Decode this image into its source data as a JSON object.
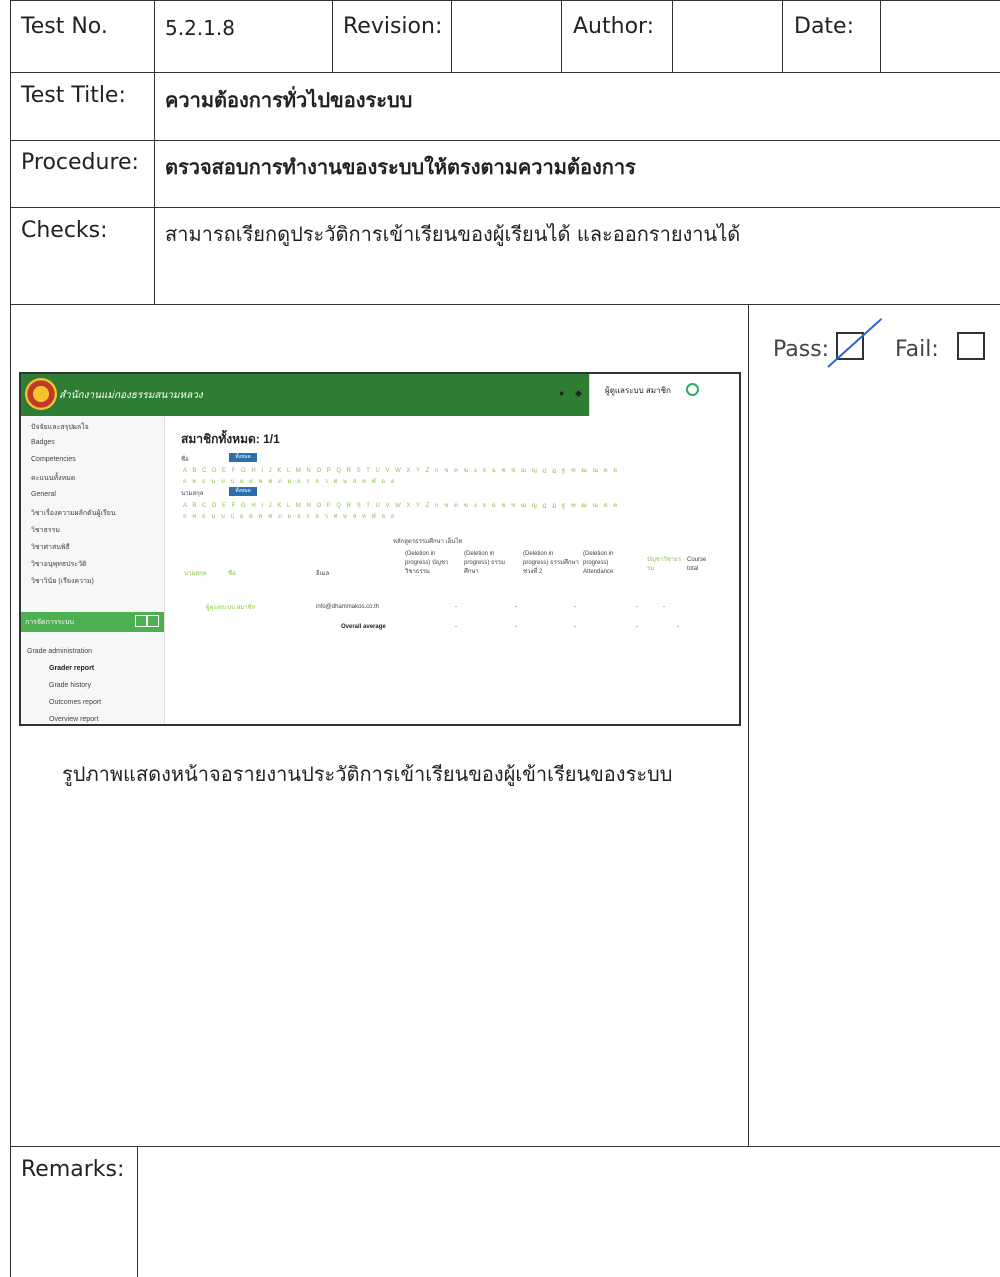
{
  "header": {
    "test_no_label": "Test No.",
    "test_no_value": "5.2.1.8",
    "revision_label": "Revision:",
    "author_label": "Author:",
    "date_label": "Date:"
  },
  "test_title": {
    "label": "Test Title:",
    "value": "ความต้องการทั่วไปของระบบ"
  },
  "procedure": {
    "label": "Procedure:",
    "value": "ตรวจสอบการทำงานของระบบให้ตรงตามความต้องการ"
  },
  "checks": {
    "label": "Checks:",
    "value": "สามารถเรียกดูประวัติการเข้าเรียนของผู้เรียนได้ และออกรายงานได้"
  },
  "result": {
    "pass_label": "Pass:",
    "fail_label": "Fail:",
    "pass_checked": true,
    "fail_checked": false
  },
  "caption": "รูปภาพแสดงหน้าจอรายงานประวัติการเข้าเรียนของผู้เข้าเรียนของระบบ",
  "remarks": {
    "label": "Remarks:"
  },
  "screenshot": {
    "site_name": "สำนักงานแม่กองธรรมสนามหลวง",
    "user_name": "ผู้ดูแลระบบ สมาชิก",
    "heading": "สมาชิกทั้งหมด: 1/1",
    "first_name_label": "ชื่อ",
    "last_name_label": "นามสกุล",
    "all_button": "ทั้งหมด",
    "alphabet_1": "A B C D E F G H I J K L M N O P Q R S T U V W X Y Z ก ข ค ฆ ง จ ฉ ช ซ ฌ ญ ฎ ฏ ฐ ฑ ฒ ณ ด ต",
    "alphabet_2": "ถ ท ธ น บ ป ผ ฝ พ ฟ ภ ม ย ร ล ว ศ ษ ส ห ฬ อ ฮ",
    "sidebar_items": [
      "ปัจจัยและสรุปผลใจ",
      "Badges",
      "Competencies",
      "คะแนนทั้งหมด",
      "General",
      "วิชาเรื่องความผลักดันผู้เรียน",
      "วิชาธรรม",
      "วิชาศาสนพิธี",
      "วิชาอนุพุทธประวัติ",
      "วิชาวินัย (เรียงความ)"
    ],
    "admin_section_label": "การจัดการระบบ",
    "grade_items": [
      "Grade administration",
      "Grader report",
      "Grade history",
      "Outcomes report",
      "Overview report"
    ],
    "course_label": "หลักสูตรธรรมศึกษา เอ็นโท",
    "columns": [
      "(Deletion in progress) บัญชาวิชาธรรม",
      "(Deletion in progress) ธรรมศึกษา",
      "(Deletion in progress) ธรรมศึกษา ช่วงที่ 2",
      "(Deletion in progress) Attendance",
      "บัญชาวิชาธรรม",
      "Course total"
    ],
    "col_sort_label": "นามสกุล",
    "col_first": "ชื่อ",
    "col_email": "อีเมล",
    "row_name": "ผู้ดูแลระบบ สมาชิก",
    "row_email": "info@dhammakos.co.th",
    "overall_label": "Overall average",
    "dash": "-"
  }
}
